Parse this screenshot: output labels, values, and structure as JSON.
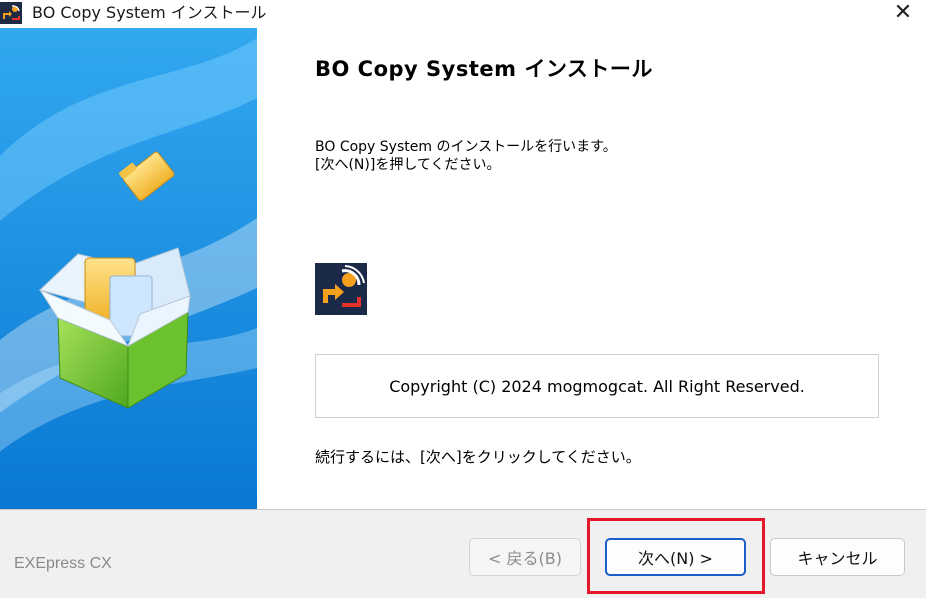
{
  "window": {
    "title": "BO Copy System インストール",
    "close_glyph": "✕"
  },
  "main": {
    "heading": "BO Copy System インストール",
    "description": "BO Copy System のインストールを行います。\n[次へ(N)]を押してください。",
    "copyright": "Copyright (C) 2024 mogmogcat. All Right Reserved.",
    "continue_text": "続行するには、[次へ]をクリックしてください。",
    "app_icon": "app-logo-icon"
  },
  "banner": {
    "illustration": "package-box-with-folders",
    "colors": {
      "sky_top": "#2aa0ec",
      "sky_bottom": "#0d7fd8",
      "box_green": "#7ccf3a"
    }
  },
  "footer": {
    "brand": "EXEpress CX",
    "back_label": "< 戻る(B)",
    "next_label": "次へ(N) >",
    "cancel_label": "キャンセル"
  },
  "colors": {
    "highlight": "#e4162a",
    "default_button_border": "#1a5fc8",
    "footer_bg": "#f0f0f0"
  }
}
